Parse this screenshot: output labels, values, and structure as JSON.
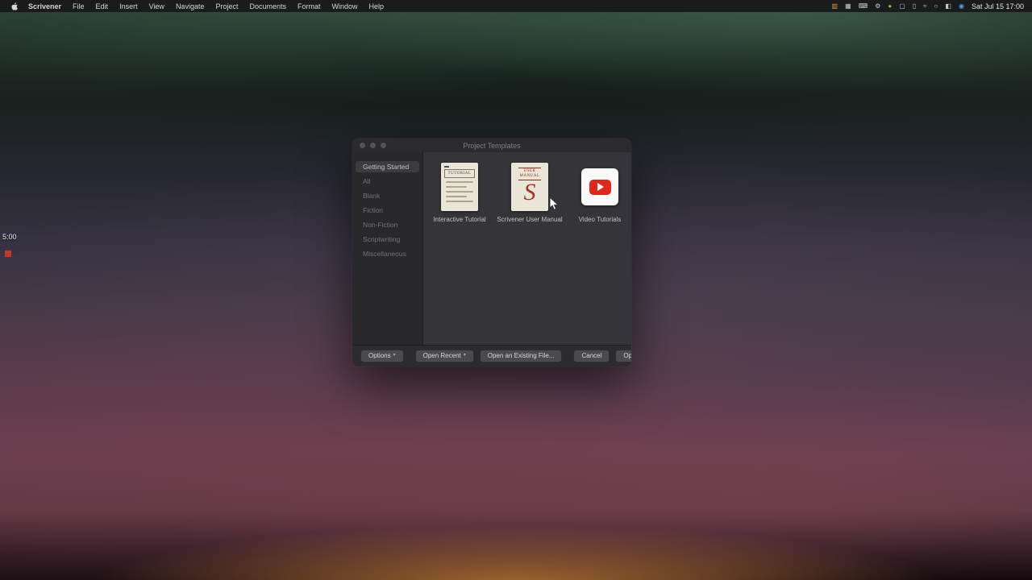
{
  "menubar": {
    "app_name": "Scrivener",
    "items": [
      "File",
      "Edit",
      "Insert",
      "View",
      "Navigate",
      "Project",
      "Documents",
      "Format",
      "Window",
      "Help"
    ],
    "status_icons": [
      {
        "name": "stats-icon",
        "glyph": "▥"
      },
      {
        "name": "grid-icon",
        "glyph": "▦"
      },
      {
        "name": "keyboard-icon",
        "glyph": "⌨"
      },
      {
        "name": "gear-icon",
        "glyph": "⚙"
      },
      {
        "name": "app-dot-icon",
        "glyph": "●"
      },
      {
        "name": "display-icon",
        "glyph": "▢"
      },
      {
        "name": "battery-icon",
        "glyph": "▯"
      },
      {
        "name": "wifi-icon",
        "glyph": "≈"
      },
      {
        "name": "search-icon",
        "glyph": "○"
      },
      {
        "name": "control-center-icon",
        "glyph": "◧"
      },
      {
        "name": "siri-icon",
        "glyph": "◉"
      }
    ],
    "clock": "Sat Jul 15 17:00"
  },
  "overlay": {
    "timer": "5:00"
  },
  "dialog": {
    "title": "Project Templates",
    "sidebar": {
      "items": [
        {
          "label": "Getting Started",
          "selected": true
        },
        {
          "label": "All",
          "selected": false
        },
        {
          "label": "Blank",
          "selected": false
        },
        {
          "label": "Fiction",
          "selected": false
        },
        {
          "label": "Non-Fiction",
          "selected": false
        },
        {
          "label": "Scriptwriting",
          "selected": false
        },
        {
          "label": "Miscellaneous",
          "selected": false
        }
      ]
    },
    "templates": [
      {
        "label": "Interactive Tutorial",
        "cover_heading": "TUTORIAL"
      },
      {
        "label": "Scrivener User Manual",
        "cover_heading": "USER\nMANUAL",
        "cover_initial": "S"
      },
      {
        "label": "Video Tutorials"
      }
    ],
    "footer": {
      "options": "Options",
      "open_recent": "Open Recent",
      "open_existing": "Open an Existing File...",
      "cancel": "Cancel",
      "open": "Open",
      "chevron": "▾"
    }
  },
  "colors": {
    "youtube_red": "#e0271c",
    "manual_red": "#a5342a",
    "record_red": "#c23a2b"
  }
}
